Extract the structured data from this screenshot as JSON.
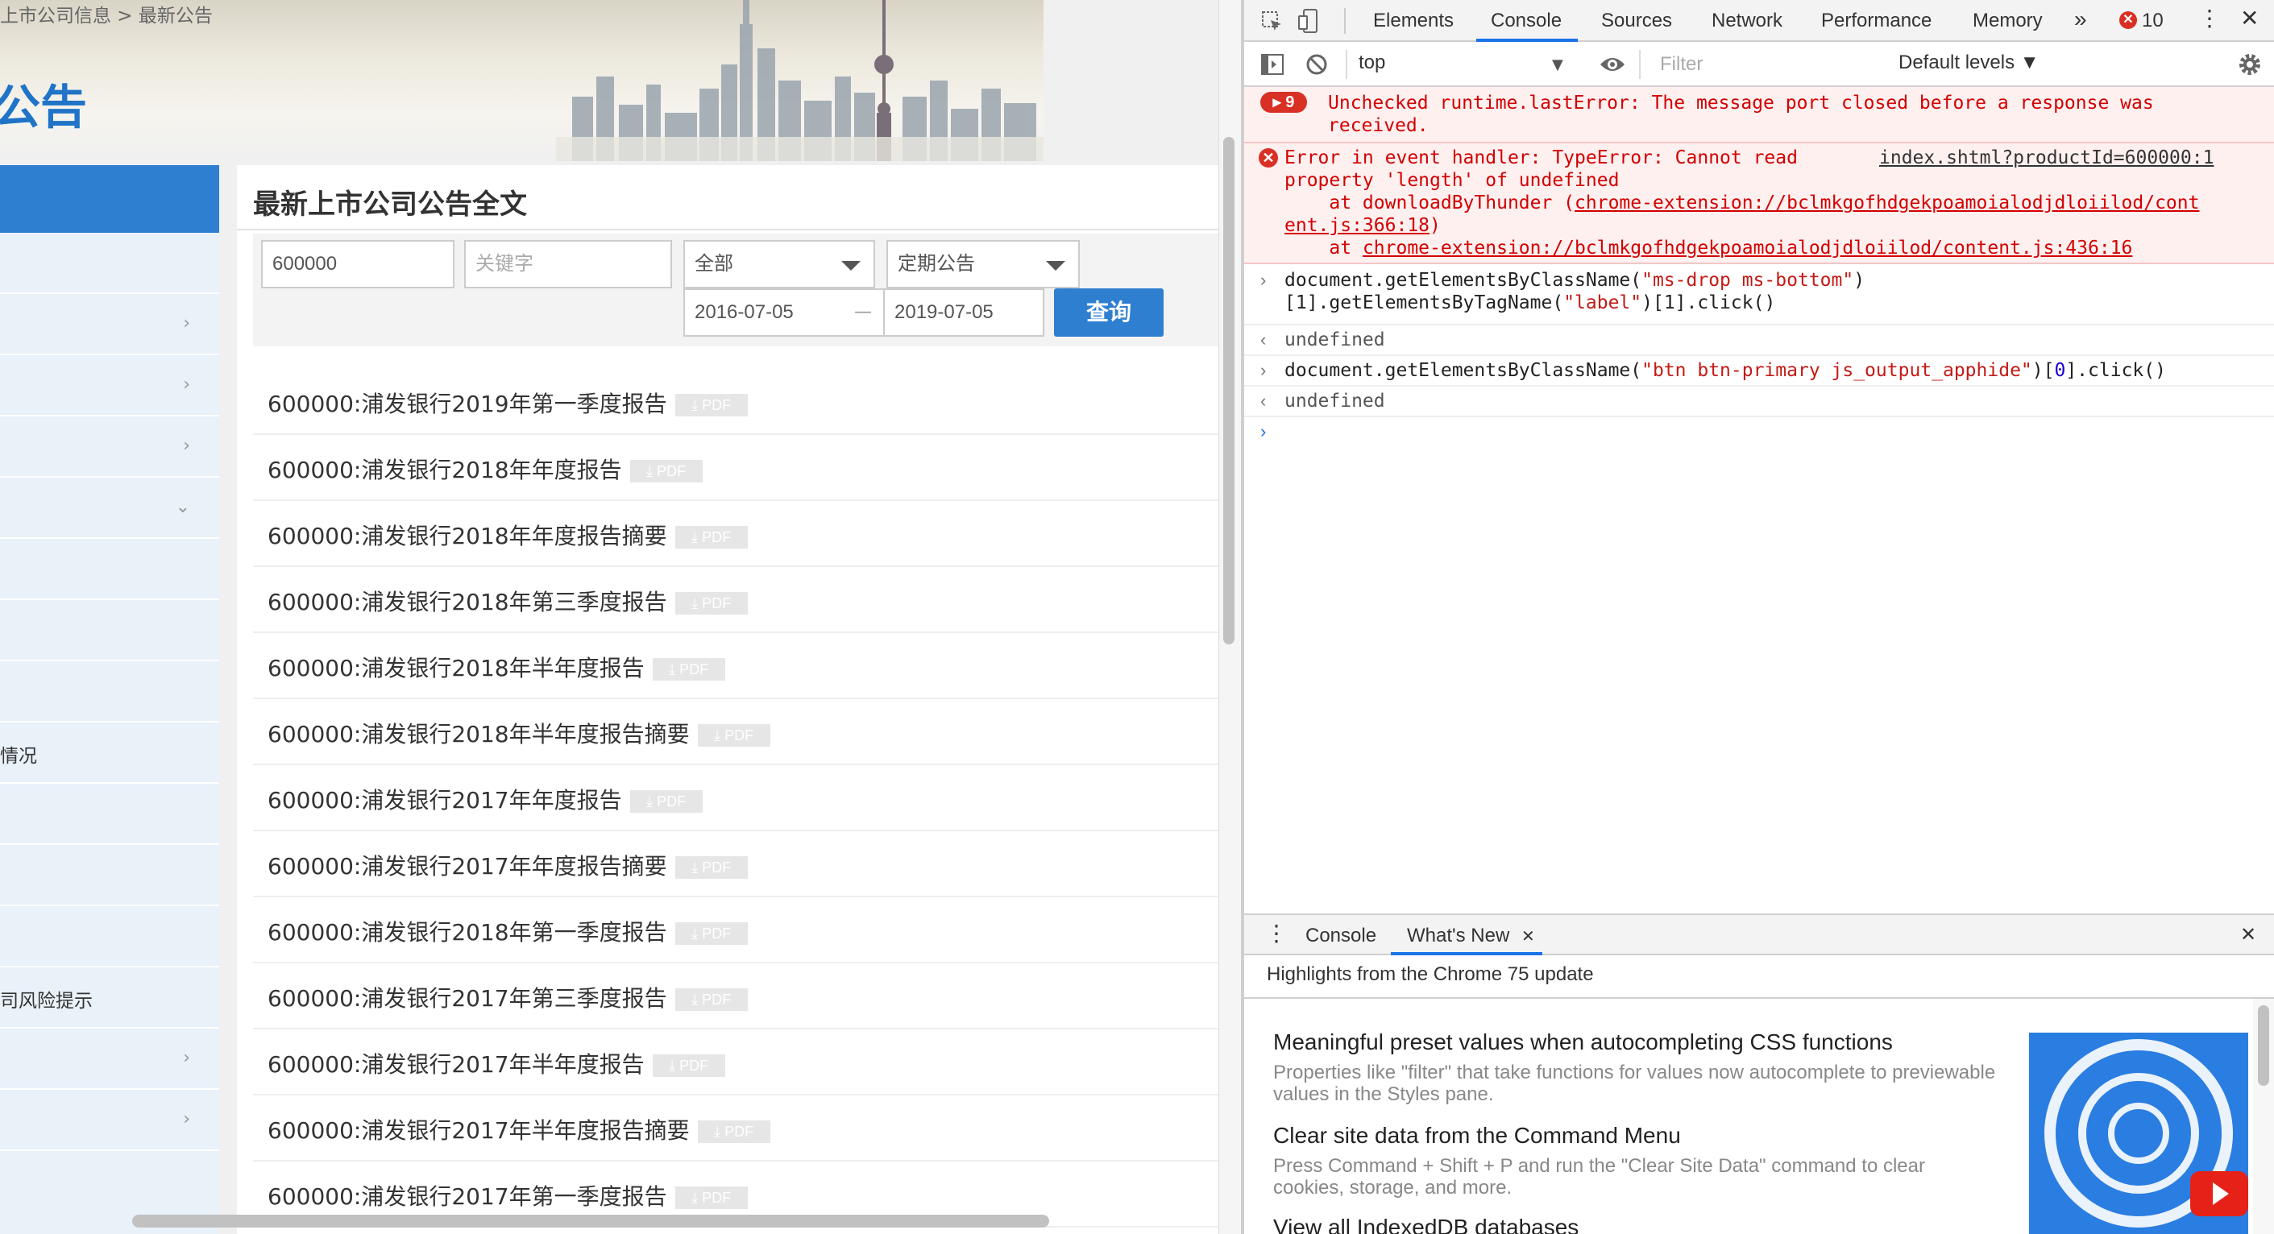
{
  "webpage": {
    "breadcrumb": "上市公司信息 > 最新公告",
    "heading": "公告",
    "sidebar_items": [
      {
        "label": "",
        "arrow": ""
      },
      {
        "label": "",
        "arrow": "›"
      },
      {
        "label": "",
        "arrow": "›"
      },
      {
        "label": "",
        "arrow": "›"
      },
      {
        "label": "",
        "arrow": "⌄"
      },
      {
        "label": "",
        "arrow": ""
      },
      {
        "label": "",
        "arrow": ""
      },
      {
        "label": "",
        "arrow": ""
      },
      {
        "label": "情况",
        "arrow": ""
      },
      {
        "label": "",
        "arrow": ""
      },
      {
        "label": "",
        "arrow": ""
      },
      {
        "label": "",
        "arrow": ""
      },
      {
        "label": "司风险提示",
        "arrow": ""
      },
      {
        "label": "",
        "arrow": "›"
      },
      {
        "label": "",
        "arrow": "›"
      }
    ],
    "panel_title": "最新上市公司公告全文",
    "filters": {
      "code_value": "600000",
      "keyword_placeholder": "关键字",
      "market_select": "全部",
      "type_select": "定期公告",
      "date_from": "2016-07-05",
      "date_sep": "—",
      "date_to": "2019-07-05",
      "query_button": "查询"
    },
    "pdf_label": "PDF",
    "announcements": [
      "600000:浦发银行2019年第一季度报告",
      "600000:浦发银行2018年年度报告",
      "600000:浦发银行2018年年度报告摘要",
      "600000:浦发银行2018年第三季度报告",
      "600000:浦发银行2018年半年度报告",
      "600000:浦发银行2018年半年度报告摘要",
      "600000:浦发银行2017年年度报告",
      "600000:浦发银行2017年年度报告摘要",
      "600000:浦发银行2018年第一季度报告",
      "600000:浦发银行2017年第三季度报告",
      "600000:浦发银行2017年半年度报告",
      "600000:浦发银行2017年半年度报告摘要",
      "600000:浦发银行2017年第一季度报告"
    ]
  },
  "devtools": {
    "tabs": [
      "Elements",
      "Console",
      "Sources",
      "Network",
      "Performance",
      "Memory"
    ],
    "more_tabs": "»",
    "error_count": "10",
    "context": "top",
    "filter_placeholder": "Filter",
    "levels": "Default levels ▼",
    "err1_badge": "9",
    "err1_line1": "Unchecked runtime.lastError: The message port closed before a response was",
    "err1_line2": "received.",
    "err2_line1": "Error in event handler: TypeError: Cannot read",
    "err2_source": "index.shtml?productId=600000:1",
    "err2_line2": "property 'length' of undefined",
    "err2_line3_prefix": "    at downloadByThunder (",
    "err2_line3_link": "chrome-extension://bclmkgofhdgekpoamoialodjdloiilod/cont",
    "err2_line4_link": "ent.js:366:18",
    "err2_line4_suffix": ")",
    "err2_line5_prefix": "    at ",
    "err2_line5_link": "chrome-extension://bclmkgofhdgekpoamoialodjdloiilod/content.js:436:16",
    "cmd1_a": "document.getElementsByClassName(",
    "cmd1_b": "\"ms-drop ms-bottom\"",
    "cmd1_c": ")",
    "cmd1_d": "[1].getElementsByTagName(",
    "cmd1_e": "\"label\"",
    "cmd1_f": ")[1].click()",
    "result1": "undefined",
    "cmd2_a": "document.getElementsByClassName(",
    "cmd2_b": "\"btn btn-primary js_output_apphide\"",
    "cmd2_c": ")[",
    "cmd2_d": "0",
    "cmd2_e": "].click()",
    "result2": "undefined",
    "drawer_tabs": [
      "Console",
      "What's New"
    ],
    "highlights": "Highlights from the Chrome 75 update",
    "whats_new": [
      {
        "title": "Meaningful preset values when autocompleting CSS functions",
        "desc": "Properties like \"filter\" that take functions for values now autocomplete to previewable values in the Styles pane."
      },
      {
        "title": "Clear site data from the Command Menu",
        "desc": "Press Command + Shift + P and run the \"Clear Site Data\" command to clear cookies, storage, and more."
      },
      {
        "title": "View all IndexedDB databases",
        "desc": ""
      }
    ]
  }
}
